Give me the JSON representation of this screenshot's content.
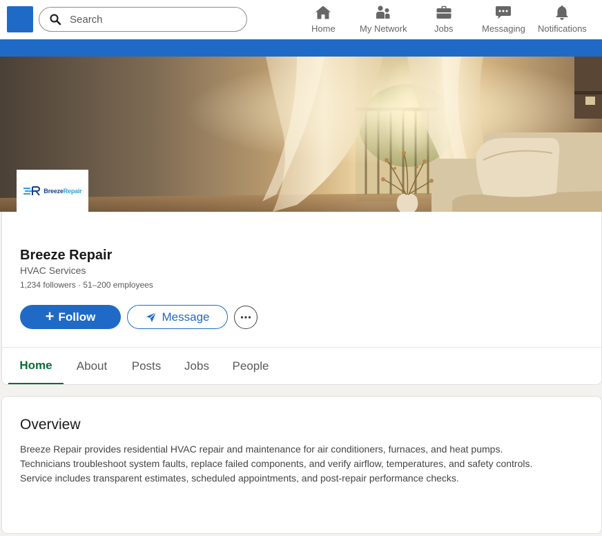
{
  "nav": {
    "search_placeholder": "Search",
    "items": [
      {
        "label": "Home",
        "icon": "home-icon"
      },
      {
        "label": "My Network",
        "icon": "people-icon"
      },
      {
        "label": "Jobs",
        "icon": "briefcase-icon"
      },
      {
        "label": "Messaging",
        "icon": "chat-icon"
      },
      {
        "label": "Notifications",
        "icon": "bell-icon"
      }
    ]
  },
  "colors": {
    "brand_blue": "#1f6ac7",
    "active_tab_green": "#0b6b3a",
    "page_background": "#f3f2ef"
  },
  "company": {
    "logo_text_a": "Breeze",
    "logo_text_b": "Repair",
    "name": "Breeze Repair",
    "industry": "HVAC Services",
    "meta": "1,234 followers · 51–200 employees"
  },
  "actions": {
    "follow": "Follow",
    "message": "Message",
    "more": "more-icon"
  },
  "tabs": [
    {
      "label": "Home",
      "active": true
    },
    {
      "label": "About",
      "active": false
    },
    {
      "label": "Posts",
      "active": false
    },
    {
      "label": "Jobs",
      "active": false
    },
    {
      "label": "People",
      "active": false
    }
  ],
  "overview": {
    "title": "Overview",
    "lines": [
      "Breeze Repair provides residential HVAC repair and maintenance for air conditioners, furnaces, and heat pumps.",
      "Technicians troubleshoot system faults, replace failed components, and verify airflow, temperatures, and safety controls.",
      "Service includes transparent estimates, scheduled appointments, and post-repair performance checks."
    ]
  }
}
